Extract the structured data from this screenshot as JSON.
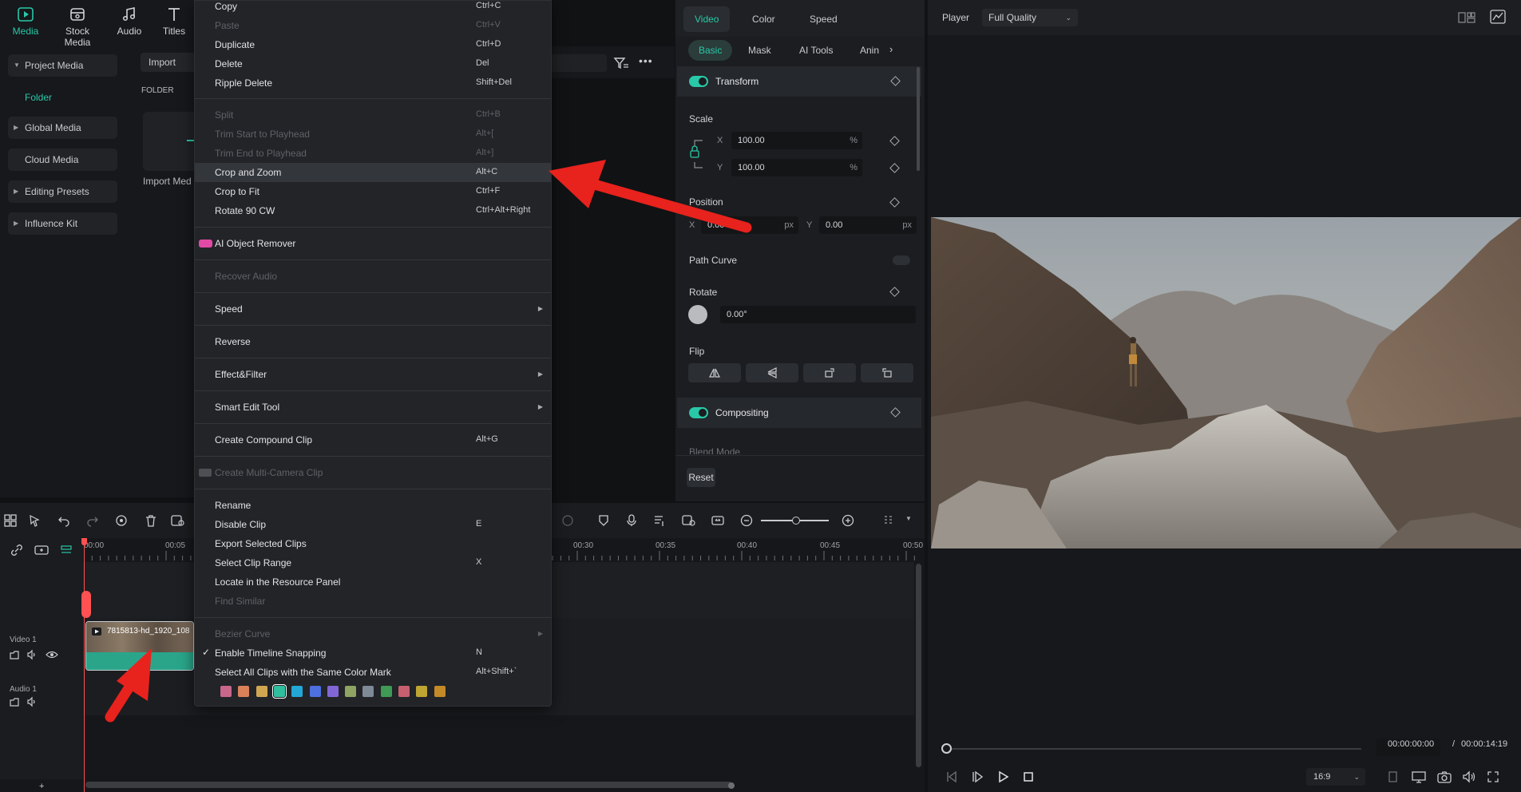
{
  "top_tabs": [
    {
      "label": "Media",
      "icon": "media-icon"
    },
    {
      "label": "Stock Media",
      "icon": "stock-media-icon"
    },
    {
      "label": "Audio",
      "icon": "music-note-icon"
    },
    {
      "label": "Titles",
      "icon": "title-T-icon"
    }
  ],
  "sidebar": {
    "items": [
      {
        "label": "Project Media"
      },
      {
        "label": "Folder"
      },
      {
        "label": "Global Media"
      },
      {
        "label": "Cloud Media"
      },
      {
        "label": "Editing Presets"
      },
      {
        "label": "Influence Kit"
      }
    ]
  },
  "media": {
    "import_label": "Import",
    "folder_label": "FOLDER",
    "import_caption": "Import Med"
  },
  "context_menu": {
    "items": [
      {
        "label": "Copy",
        "shortcut": "Ctrl+C"
      },
      {
        "label": "Paste",
        "shortcut": "Ctrl+V"
      },
      {
        "label": "Duplicate",
        "shortcut": "Ctrl+D"
      },
      {
        "label": "Delete",
        "shortcut": "Del"
      },
      {
        "label": "Ripple Delete",
        "shortcut": "Shift+Del"
      },
      {
        "label": "Split",
        "shortcut": "Ctrl+B"
      },
      {
        "label": "Trim Start to Playhead",
        "shortcut": "Alt+["
      },
      {
        "label": "Trim End to Playhead",
        "shortcut": "Alt+]"
      },
      {
        "label": "Crop and Zoom",
        "shortcut": "Alt+C"
      },
      {
        "label": "Crop to Fit",
        "shortcut": "Ctrl+F"
      },
      {
        "label": "Rotate 90 CW",
        "shortcut": "Ctrl+Alt+Right"
      },
      {
        "label": "AI Object Remover",
        "shortcut": ""
      },
      {
        "label": "Recover Audio",
        "shortcut": ""
      },
      {
        "label": "Speed",
        "shortcut": ""
      },
      {
        "label": "Reverse",
        "shortcut": ""
      },
      {
        "label": "Effect&Filter",
        "shortcut": ""
      },
      {
        "label": "Smart Edit Tool",
        "shortcut": ""
      },
      {
        "label": "Create Compound Clip",
        "shortcut": "Alt+G"
      },
      {
        "label": "Create Multi-Camera Clip",
        "shortcut": ""
      },
      {
        "label": "Rename",
        "shortcut": ""
      },
      {
        "label": "Disable Clip",
        "shortcut": "E"
      },
      {
        "label": "Export Selected Clips",
        "shortcut": ""
      },
      {
        "label": "Select Clip Range",
        "shortcut": "X"
      },
      {
        "label": "Locate in the Resource Panel",
        "shortcut": ""
      },
      {
        "label": "Find Similar",
        "shortcut": ""
      },
      {
        "label": "Bezier Curve",
        "shortcut": ""
      },
      {
        "label": "Enable Timeline Snapping",
        "shortcut": "N"
      },
      {
        "label": "Select All Clips with the Same Color Mark",
        "shortcut": "Alt+Shift+`"
      }
    ],
    "color_marks": [
      "#c9678a",
      "#d9825a",
      "#d1a651",
      "#2fbf9f",
      "#22a7d6",
      "#4d6fe0",
      "#8366d6",
      "#8fa363",
      "#7f8a97",
      "#3f9a55",
      "#c66070",
      "#bfa532",
      "#c48a28"
    ]
  },
  "properties": {
    "tabs": [
      "Video",
      "Color",
      "Speed"
    ],
    "subtabs": [
      "Basic",
      "Mask",
      "AI Tools",
      "Anin"
    ],
    "transform": {
      "title": "Transform",
      "scale_label": "Scale",
      "scale_x_axis": "X",
      "scale_x": "100.00",
      "scale_y_axis": "Y",
      "scale_y": "100.00",
      "percent": "%",
      "position_label": "Position",
      "pos_x_axis": "X",
      "pos_x": "0.00",
      "pos_y_axis": "Y",
      "pos_y": "0.00",
      "px": "px",
      "path_curve_label": "Path Curve",
      "rotate_label": "Rotate",
      "rotate_value": "0.00°",
      "flip_label": "Flip"
    },
    "compositing": {
      "title": "Compositing",
      "blend_mode_label": "Blend Mode"
    },
    "reset_label": "Reset"
  },
  "player": {
    "label": "Player",
    "quality": "Full Quality",
    "current_time": "00:00:00:00",
    "separator": "/",
    "total_time": "00:00:14:19",
    "aspect_ratio": "16:9"
  },
  "timeline": {
    "ruler": [
      "00:00",
      "00:05",
      "00:30",
      "00:35",
      "00:40",
      "00:45",
      "00:50"
    ],
    "video_track_label": "Video 1",
    "audio_track_label": "Audio 1",
    "clip_name": "7815813-hd_1920_108"
  },
  "colors": {
    "accent": "#28c8a8",
    "playhead": "#ff5151",
    "annotation_arrow": "#e8221d"
  }
}
